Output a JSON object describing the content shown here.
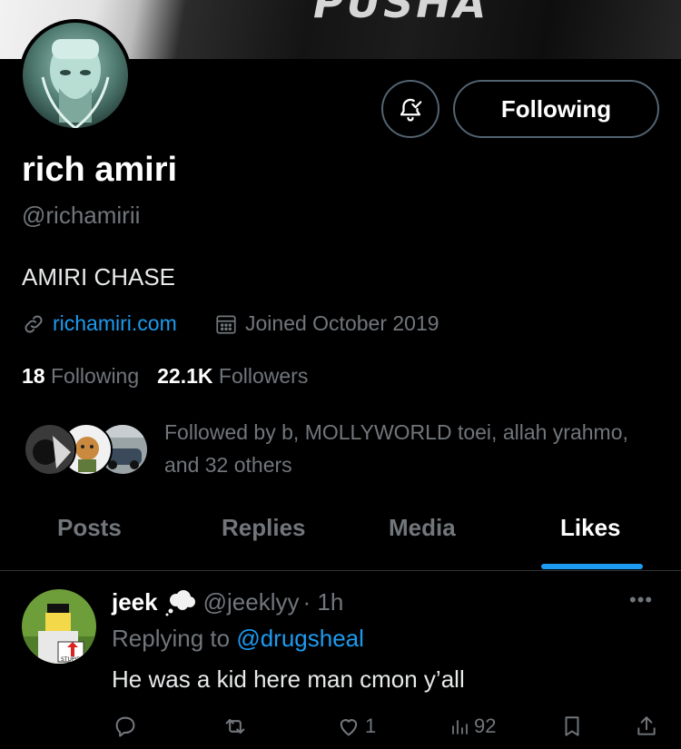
{
  "banner": {
    "mark_text": "PUSHA"
  },
  "profile": {
    "name": "rich amiri",
    "handle": "@richamirii",
    "bio": "AMIRI CHASE",
    "website": "richamiri.com",
    "joined": "Joined October 2019",
    "following_count": "18",
    "following_label": "Following",
    "followers_count": "22.1K",
    "followers_label": "Followers",
    "followed_by": "Followed by b, MOLLYWORLD toei, allah yrahmo, and 32 others"
  },
  "actions": {
    "notify_icon": "bell-check-icon",
    "follow_button_label": "Following"
  },
  "tabs": [
    {
      "label": "Posts",
      "active": false
    },
    {
      "label": "Replies",
      "active": false
    },
    {
      "label": "Media",
      "active": false
    },
    {
      "label": "Likes",
      "active": true
    }
  ],
  "tweet": {
    "author_name": "jeek",
    "author_badge_icon": "thought-bubble-emoji",
    "author_handle": "@jeeklyy",
    "time": "· 1h",
    "replying_prefix": "Replying to",
    "replying_to": "@drugsheal",
    "text": "He was a kid here man cmon y’all",
    "avatar_sign_text": "STUPID",
    "reply_count": "",
    "retweet_count": "",
    "like_count": "1",
    "view_count": "92"
  },
  "colors": {
    "accent": "#1d9bf0",
    "muted": "#71767b",
    "background": "#000000",
    "border": "#2f3336"
  }
}
